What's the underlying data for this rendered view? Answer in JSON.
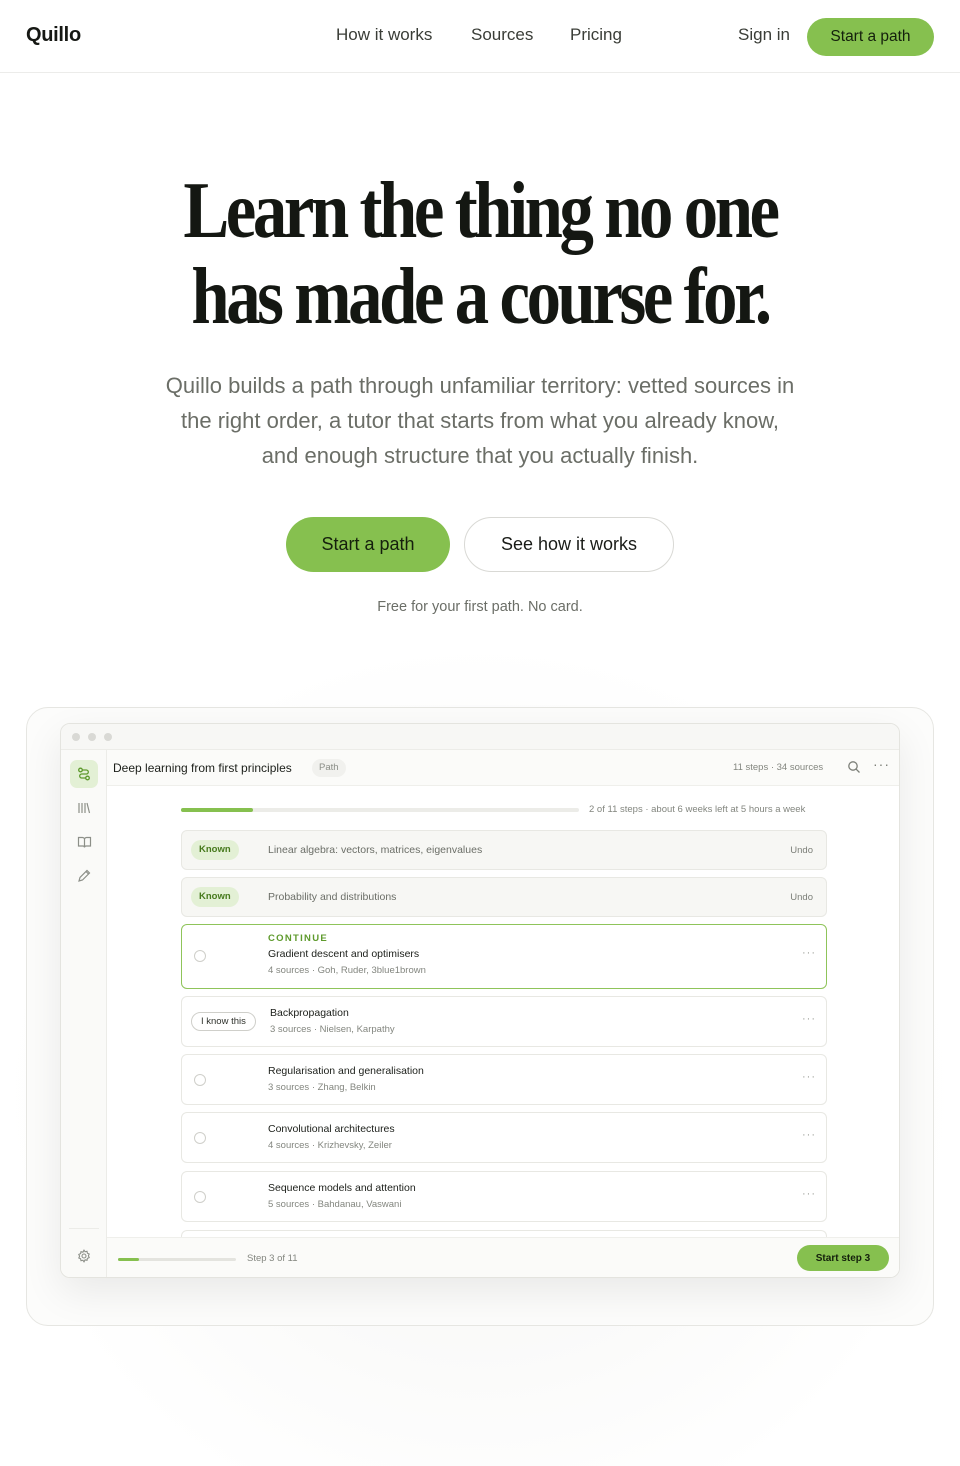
{
  "nav": {
    "logo": "Quillo",
    "links": [
      "How it works",
      "Sources",
      "Pricing"
    ],
    "sign_in": "Sign in",
    "cta": "Start a path"
  },
  "hero": {
    "title_line1": "Learn the thing no one",
    "title_line2": "has made a course for.",
    "subtitle": "Quillo builds a path through unfamiliar territory: vetted sources in the right order, a tutor that starts from what you already know, and enough structure that you actually finish.",
    "primary_cta": "Start a path",
    "secondary_cta": "See how it works",
    "fine_print": "Free for your first path. No card."
  },
  "app": {
    "path_title": "Deep learning from first principles",
    "path_chip": "Path",
    "meta": "11 steps · 34 sources",
    "progress_fraction": 0.18,
    "progress_label": "2 of 11 steps · about 6 weeks left at 5 hours a week",
    "known_badge": "Known",
    "undo_label": "Undo",
    "known_rows": [
      "Linear algebra: vectors, matrices, eigenvalues",
      "Probability and distributions"
    ],
    "active_step": {
      "kicker": "CONTINUE",
      "title": "Gradient descent and optimisers",
      "sources": "4 sources · Goh, Ruder, 3blue1brown"
    },
    "i_know_this": "I know this",
    "steps": [
      {
        "title": "Backpropagation",
        "sources": "3 sources · Nielsen, Karpathy"
      },
      {
        "title": "Regularisation and generalisation",
        "sources": "3 sources · Zhang, Belkin"
      },
      {
        "title": "Convolutional architectures",
        "sources": "4 sources · Krizhevsky, Zeiler"
      },
      {
        "title": "Sequence models and attention",
        "sources": "5 sources · Bahdanau, Vaswani"
      }
    ],
    "more_glyph": "···",
    "bottom": {
      "progress_fraction": 0.18,
      "label": "Step 3 of 11",
      "cta": "Start step 3"
    },
    "sidebar_icons": [
      "path-icon",
      "library-icon",
      "book-icon",
      "pencil-icon",
      "settings-icon"
    ]
  },
  "colors": {
    "accent": "#86c04f",
    "accent_soft": "#e3f0d5",
    "text": "#1c1f1a",
    "muted": "#6b6e67"
  }
}
